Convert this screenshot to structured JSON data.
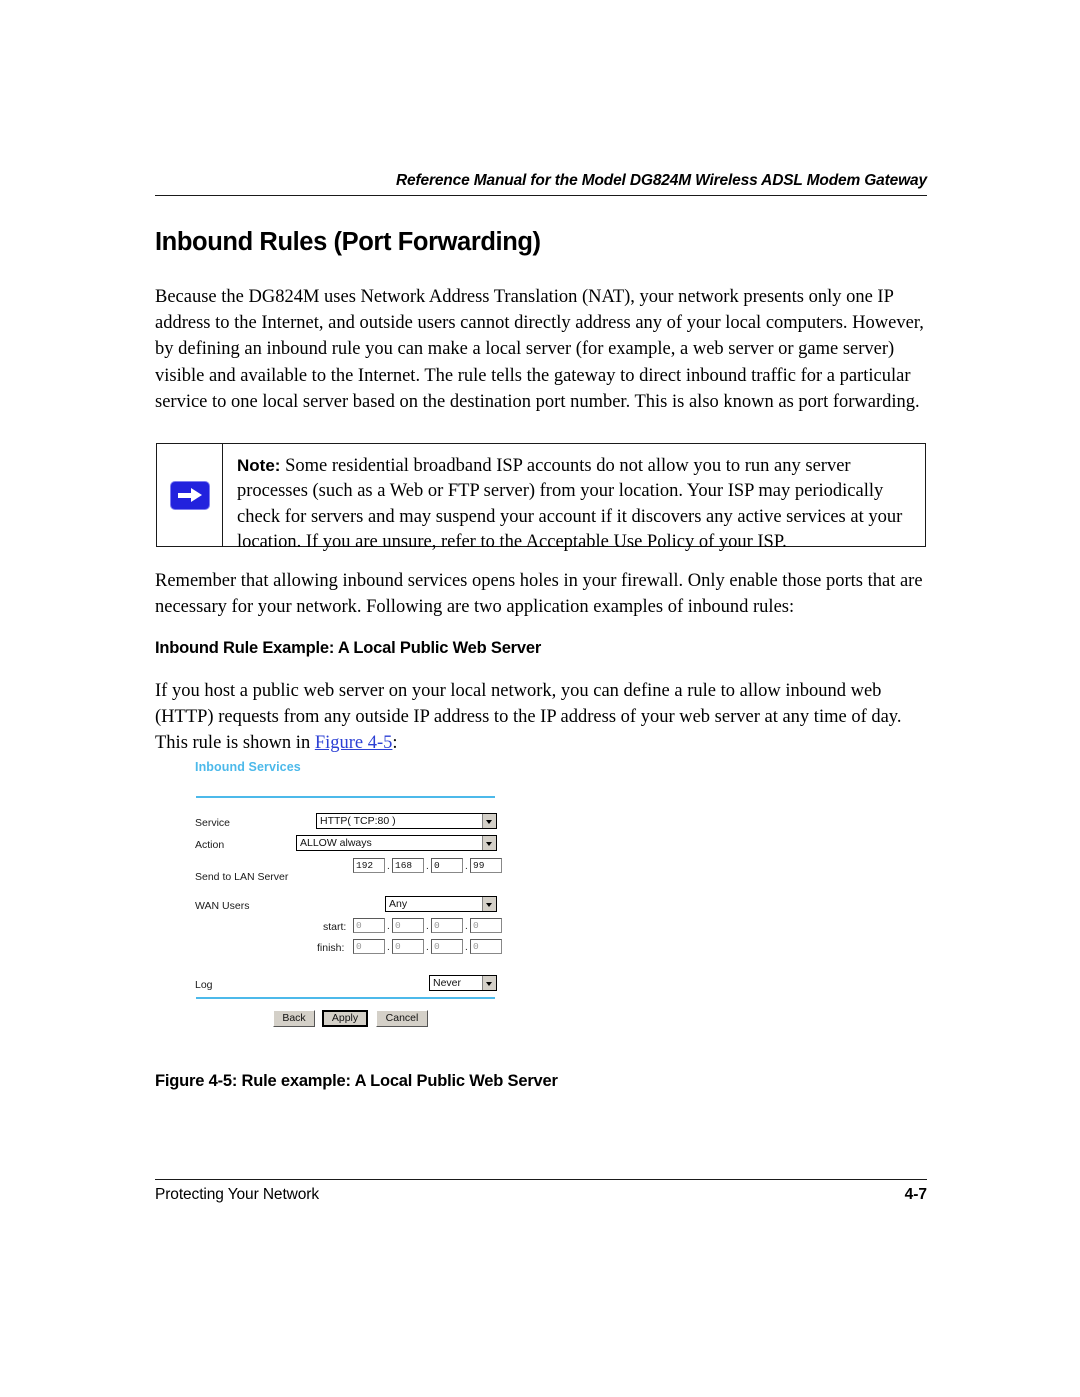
{
  "header": {
    "running_title": "Reference Manual for the Model DG824M Wireless ADSL Modem Gateway"
  },
  "main": {
    "heading": "Inbound Rules (Port Forwarding)",
    "intro_paragraph": "Because the DG824M uses Network Address Translation (NAT), your network presents only one IP address to the Internet, and outside users cannot directly address any of your local computers. However, by defining an inbound rule you can make a local server (for example, a web server or game server) visible and available to the Internet. The rule tells the gateway to direct inbound traffic for a particular service to one local server based on the destination port number. This is also known as port forwarding.",
    "note": {
      "icon": "blue-arrow-icon",
      "label": "Note:",
      "text": "Some residential broadband ISP accounts do not allow you to run any server processes (such as a Web or FTP server) from your location. Your ISP may periodically check for servers and may suspend your account if it discovers any active services at your location. If you are unsure, refer to the Acceptable Use Policy of your ISP."
    },
    "remember_paragraph": "Remember that allowing inbound services opens holes in your firewall. Only enable those ports that are necessary for your network. Following are two application examples of inbound rules:",
    "subheading": "Inbound Rule Example: A Local Public Web Server",
    "example_paragraph_part1": "If you host a public web server on your local network, you can define a rule to allow inbound web (HTTP) requests from any outside IP address to the IP address of your web server at any time of day. This rule is shown in ",
    "example_link": "Figure 4-5",
    "example_paragraph_part2": ":",
    "figure_caption": "Figure 4-5: Rule example: A Local Public Web Server"
  },
  "figure": {
    "title": "Inbound Services",
    "accent_color": "#4cb9ea",
    "rows": {
      "service": {
        "label": "Service",
        "value": "HTTP( TCP:80 )"
      },
      "action": {
        "label": "Action",
        "value": "ALLOW always"
      },
      "send_to_lan_server": {
        "label": "Send to LAN Server",
        "octets": [
          "192",
          "168",
          "0",
          "99"
        ]
      },
      "wan_users": {
        "label": "WAN Users",
        "value": "Any",
        "start_label": "start:",
        "start_octets": [
          "0",
          "0",
          "0",
          "0"
        ],
        "finish_label": "finish:",
        "finish_octets": [
          "0",
          "0",
          "0",
          "0"
        ]
      },
      "log": {
        "label": "Log",
        "value": "Never"
      }
    },
    "buttons": {
      "back": "Back",
      "apply": "Apply",
      "cancel": "Cancel"
    }
  },
  "footer": {
    "section": "Protecting Your Network",
    "page_number": "4-7"
  }
}
